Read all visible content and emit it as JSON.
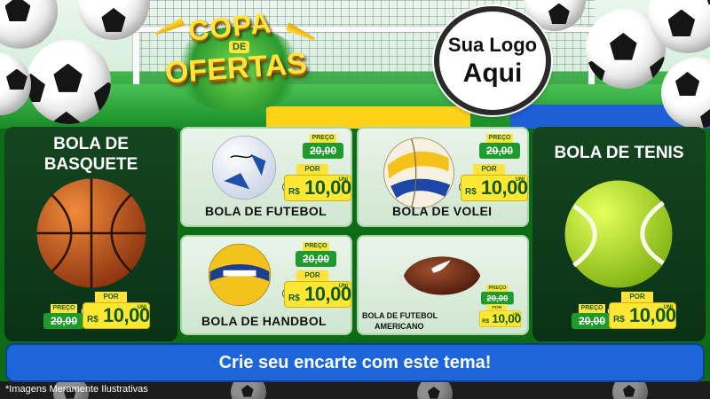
{
  "header": {
    "campaign_logo": {
      "line1": "COPA",
      "connector": "DE",
      "line2": "OFERTAS"
    },
    "brand_badge": {
      "line1": "Sua Logo",
      "line2": "Aqui"
    }
  },
  "products": [
    {
      "name": "BOLA DE BASQUETE",
      "preco_label": "PREÇO",
      "old_price": "20,00",
      "por_label": "POR",
      "currency": "R$",
      "price": "10,00",
      "unit": "UNI"
    },
    {
      "name": "BOLA DE FUTEBOL",
      "preco_label": "PREÇO",
      "old_price": "20,00",
      "por_label": "POR",
      "currency": "R$",
      "price": "10,00",
      "unit": "UNI"
    },
    {
      "name": "BOLA DE VOLEI",
      "preco_label": "PREÇO",
      "old_price": "20,00",
      "por_label": "POR",
      "currency": "R$",
      "price": "10,00",
      "unit": "UNI"
    },
    {
      "name": "BOLA DE HANDBOL",
      "preco_label": "PREÇO",
      "old_price": "20,00",
      "por_label": "POR",
      "currency": "R$",
      "price": "10,00",
      "unit": "UNI"
    },
    {
      "name_line1": "BOLA DE FUTEBOL",
      "name_line2": "AMERICANO",
      "preco_label": "PREÇO",
      "old_price": "20,00",
      "por_label": "POR",
      "currency": "R$",
      "price": "10,00",
      "unit": "UNI"
    },
    {
      "name": "BOLA DE TENIS",
      "preco_label": "PREÇO",
      "old_price": "20,00",
      "por_label": "POR",
      "currency": "R$",
      "price": "10,00",
      "unit": "UNI"
    }
  ],
  "banner": {
    "text": "Crie seu encarte com este tema!"
  },
  "footer": {
    "disclaimer": "*Imagens Meramente Ilustrativas"
  },
  "colors": {
    "panel_dark": "#0a3216",
    "card_light": "#e3f1e3",
    "price_yellow": "#ffe733",
    "price_green": "#1f9a2c",
    "banner_blue": "#1c66d9"
  }
}
